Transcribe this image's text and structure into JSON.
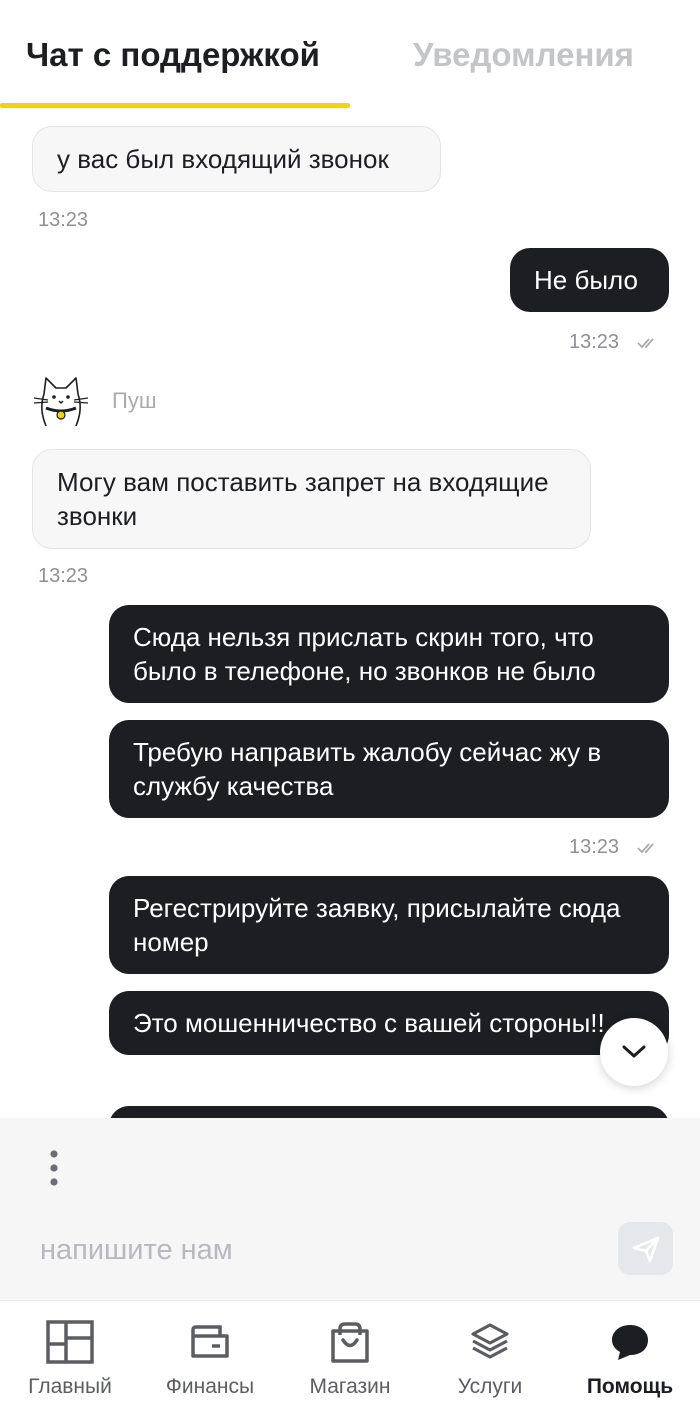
{
  "tabs": {
    "chat": "Чат с поддержкой",
    "notifications": "Уведомления"
  },
  "agent": {
    "name": "Пуш"
  },
  "messages": [
    {
      "text": "у вас был входящий звонок",
      "time": "13:23"
    },
    {
      "text": "Не было",
      "time": "13:23"
    },
    {
      "text": "Могу вам поставить запрет на входящие звонки",
      "time": "13:23"
    },
    {
      "text": "Сюда нельзя прислать скрин того, что было в телефоне, но звонков не было"
    },
    {
      "text": "Требую направить жалобу сейчас жу в службу качества",
      "time": "13:23"
    },
    {
      "text": "Регестрируйте заявку, присылайте сюда номер"
    },
    {
      "text": "Это мошенничество с вашей стороны!!"
    }
  ],
  "composer": {
    "placeholder": "напишите нам"
  },
  "nav": [
    {
      "label": "Главный",
      "icon": "dashboard-icon"
    },
    {
      "label": "Финансы",
      "icon": "wallet-icon"
    },
    {
      "label": "Магазин",
      "icon": "shopping-bag-icon"
    },
    {
      "label": "Услуги",
      "icon": "layers-icon"
    },
    {
      "label": "Помощь",
      "icon": "chat-bubble-icon",
      "active": true
    }
  ],
  "colors": {
    "accent": "#f5d20d",
    "outgoing_bubble": "#1d1e22",
    "incoming_bubble": "#f7f7f8"
  }
}
